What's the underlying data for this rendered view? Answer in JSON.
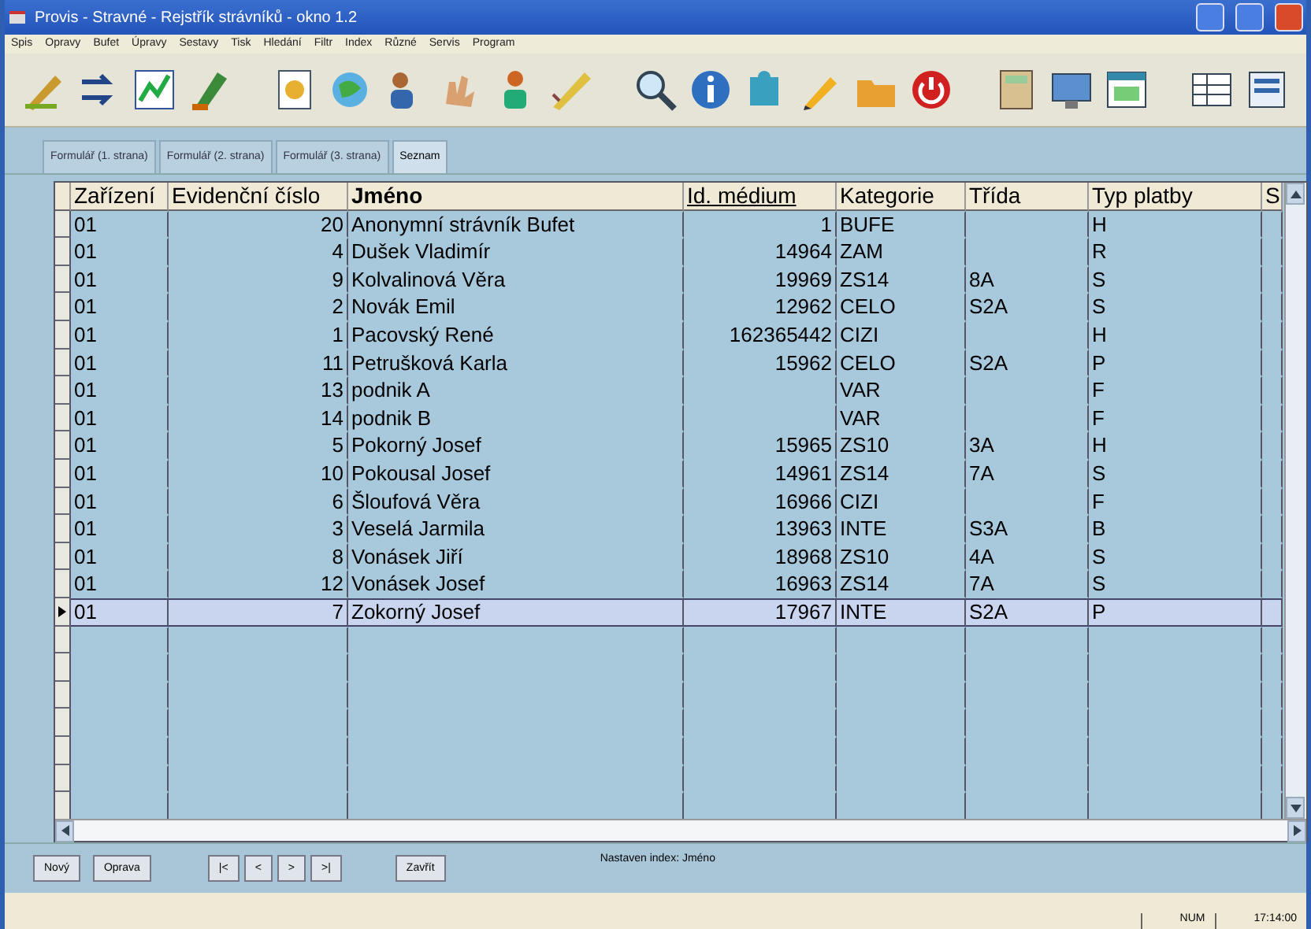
{
  "window": {
    "title": "Provis - Stravné - Rejstřík strávníků - okno 1.2"
  },
  "menu": [
    "Spis",
    "Opravy",
    "Bufet",
    "Úpravy",
    "Sestavy",
    "Tisk",
    "Hledání",
    "Filtr",
    "Index",
    "Různé",
    "Servis",
    "Program"
  ],
  "tabs": [
    {
      "label": "Formulář (1. strana)",
      "selected": false
    },
    {
      "label": "Formulář (2. strana)",
      "selected": false
    },
    {
      "label": "Formulář (3. strana)",
      "selected": false
    },
    {
      "label": "Seznam",
      "selected": true
    }
  ],
  "table": {
    "columns": [
      "Zařízení",
      "Evidenční číslo",
      "Jméno",
      "Id. médium",
      "Kategorie",
      "Třída",
      "Typ platby",
      "S"
    ],
    "rows": [
      {
        "cells": [
          "01",
          "20",
          "Anonymní strávník Bufet",
          "1",
          "BUFE",
          "",
          "H"
        ],
        "selected": false
      },
      {
        "cells": [
          "01",
          "4",
          "Dušek Vladimír",
          "14964",
          "ZAM",
          "",
          "R"
        ],
        "selected": false
      },
      {
        "cells": [
          "01",
          "9",
          "Kolvalinová Věra",
          "19969",
          "ZS14",
          "8A",
          "S"
        ],
        "selected": false
      },
      {
        "cells": [
          "01",
          "2",
          "Novák Emil",
          "12962",
          "CELO",
          "S2A",
          "S"
        ],
        "selected": false
      },
      {
        "cells": [
          "01",
          "1",
          "Pacovský René",
          "162365442",
          "CIZI",
          "",
          "H"
        ],
        "selected": false
      },
      {
        "cells": [
          "01",
          "11",
          "Petrušková Karla",
          "15962",
          "CELO",
          "S2A",
          "P"
        ],
        "selected": false
      },
      {
        "cells": [
          "01",
          "13",
          "podnik A",
          "",
          "VAR",
          "",
          "F"
        ],
        "selected": false
      },
      {
        "cells": [
          "01",
          "14",
          "podnik B",
          "",
          "VAR",
          "",
          "F"
        ],
        "selected": false
      },
      {
        "cells": [
          "01",
          "5",
          "Pokorný Josef",
          "15965",
          "ZS10",
          "3A",
          "H"
        ],
        "selected": false
      },
      {
        "cells": [
          "01",
          "10",
          "Pokousal Josef",
          "14961",
          "ZS14",
          "7A",
          "S"
        ],
        "selected": false
      },
      {
        "cells": [
          "01",
          "6",
          "Šloufová Věra",
          "16966",
          "CIZI",
          "",
          "F"
        ],
        "selected": false
      },
      {
        "cells": [
          "01",
          "3",
          "Veselá Jarmila",
          "13963",
          "INTE",
          "S3A",
          "B"
        ],
        "selected": false
      },
      {
        "cells": [
          "01",
          "8",
          "Vonásek Jiří",
          "18968",
          "ZS10",
          "4A",
          "S"
        ],
        "selected": false
      },
      {
        "cells": [
          "01",
          "12",
          "Vonásek Josef",
          "16963",
          "ZS14",
          "7A",
          "S"
        ],
        "selected": false
      },
      {
        "cells": [
          "01",
          "7",
          "Zokorný Josef",
          "17967",
          "INTE",
          "S2A",
          "P"
        ],
        "selected": true
      }
    ]
  },
  "buttons": [
    "Nový",
    "Oprava"
  ],
  "navigation": [
    "|<",
    "<",
    ">",
    ">|"
  ],
  "close_button": "Zavřít",
  "index_note": "Nastaven index: Jméno",
  "status_bar": {
    "keyboard": "NUM",
    "time": "17:14:00"
  }
}
